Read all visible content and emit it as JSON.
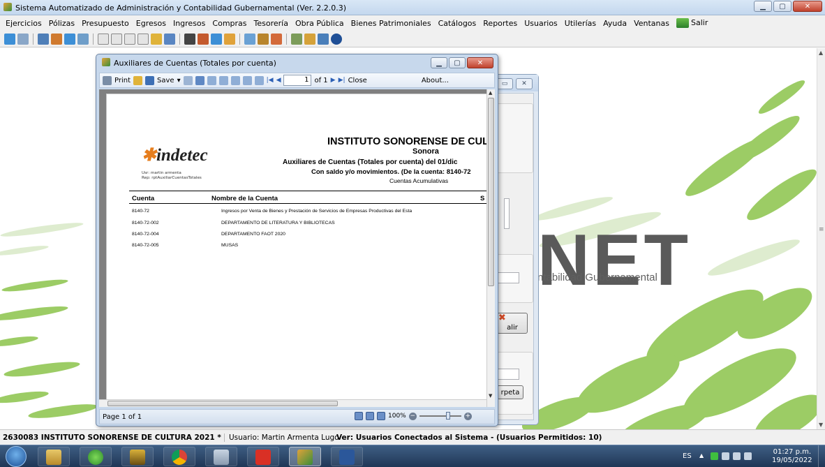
{
  "window": {
    "title": "Sistema Automatizado de Administración y Contabilidad Gubernamental  (Ver. 2.2.0.3)"
  },
  "menu": [
    {
      "label": "Ejercicios"
    },
    {
      "label": "Pólizas"
    },
    {
      "label": "Presupuesto"
    },
    {
      "label": "Egresos"
    },
    {
      "label": "Ingresos"
    },
    {
      "label": "Compras"
    },
    {
      "label": "Tesorería"
    },
    {
      "label": "Obra Pública"
    },
    {
      "label": "Bienes Patrimoniales"
    },
    {
      "label": "Catálogos"
    },
    {
      "label": "Reportes"
    },
    {
      "label": "Usuarios"
    },
    {
      "label": "Utilerías"
    },
    {
      "label": "Ayuda"
    },
    {
      "label": "Ventanas"
    }
  ],
  "menu_exit": "Salir",
  "background": {
    "brand": "NET",
    "subtitle": "ntabilidad Gubernamental"
  },
  "bg_dialog": {
    "salir": "alir",
    "carpeta": "rpeta"
  },
  "report": {
    "window_title": "Auxiliares de Cuentas (Totales por cuenta)",
    "toolbar": {
      "print": "Print",
      "save": "Save",
      "page_value": "1",
      "page_of": "of 1",
      "close": "Close",
      "about": "About..."
    },
    "logo": "indetec",
    "user_line": "Usr: martin armenta",
    "rep_line": "Rep: rptAuxiliarCuentasTotales",
    "institute": "INSTITUTO SONORENSE DE CULTURA",
    "state": "Sonora",
    "report_title": "Auxiliares de Cuentas (Totales por cuenta) del 01/dic",
    "saldo_line": "Con saldo y/o movimientos. (De la cuenta: 8140-72",
    "acumulativas": "Cuentas Acumulativas",
    "columns": {
      "cuenta": "Cuenta",
      "nombre": "Nombre de la Cuenta",
      "saldo": "S"
    },
    "rows": [
      {
        "cuenta": "8140-72",
        "nombre": "Ingresos por Venta de Bienes y Prestación de Servicios de Empresas Productivas del Esta"
      },
      {
        "cuenta": "8140-72-002",
        "nombre": "DEPARTAMENTO DE LITERATURA Y BIBLIOTECAS"
      },
      {
        "cuenta": "8140-72-004",
        "nombre": "DEPARTAMENTO FAOT 2020"
      },
      {
        "cuenta": "8140-72-005",
        "nombre": "MUSAS"
      }
    ],
    "status_page": "Page 1 of 1",
    "zoom": "100%"
  },
  "statusbar": {
    "entity": "2630083 INSTITUTO SONORENSE DE CULTURA  2021  *",
    "user": "Usuario: Martin Armenta Lugo",
    "connected": "Ver: Usuarios Conectados al Sistema - (Usuarios Permitidos: 10)"
  },
  "tray": {
    "lang": "ES",
    "time": "01:27 p.m.",
    "date": "19/05/2022"
  },
  "colors": {
    "accent": "#e67e1e",
    "leaf_green": "#7cb342"
  }
}
